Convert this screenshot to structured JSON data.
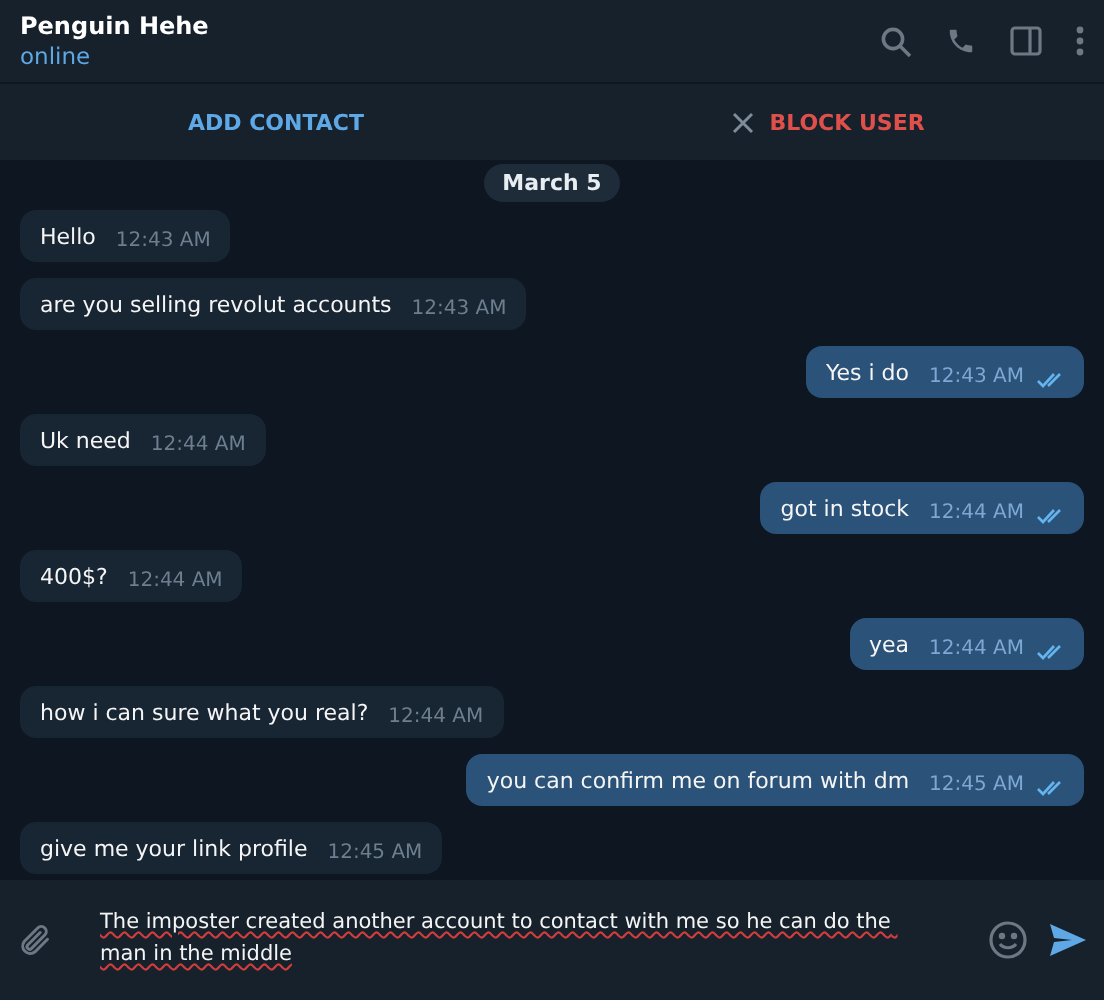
{
  "header": {
    "name": "Penguin Hehe",
    "status": "online"
  },
  "actions": {
    "add": "ADD CONTACT",
    "block": "BLOCK USER"
  },
  "date": "March 5",
  "messages": [
    {
      "kind": "in",
      "text": "Hello",
      "time": "12:43 AM"
    },
    {
      "kind": "in",
      "text": "are you selling revolut accounts",
      "time": "12:43 AM"
    },
    {
      "kind": "out",
      "text": "Yes i do",
      "time": "12:43 AM",
      "read": true
    },
    {
      "kind": "in",
      "text": "Uk need",
      "time": "12:44 AM"
    },
    {
      "kind": "out",
      "text": "got in stock",
      "time": "12:44 AM",
      "read": true
    },
    {
      "kind": "in",
      "text": "400$?",
      "time": "12:44 AM"
    },
    {
      "kind": "out",
      "text": "yea",
      "time": "12:44 AM",
      "read": true
    },
    {
      "kind": "in",
      "text": "how i can sure what you real?",
      "time": "12:44 AM"
    },
    {
      "kind": "out",
      "text": "you can confirm me on forum with dm",
      "time": "12:45 AM",
      "read": true
    },
    {
      "kind": "in",
      "text": "give me your link profile",
      "time": "12:45 AM"
    }
  ],
  "composer": {
    "value": "The imposter created another account to contact with me so he can do the man in the middle"
  }
}
